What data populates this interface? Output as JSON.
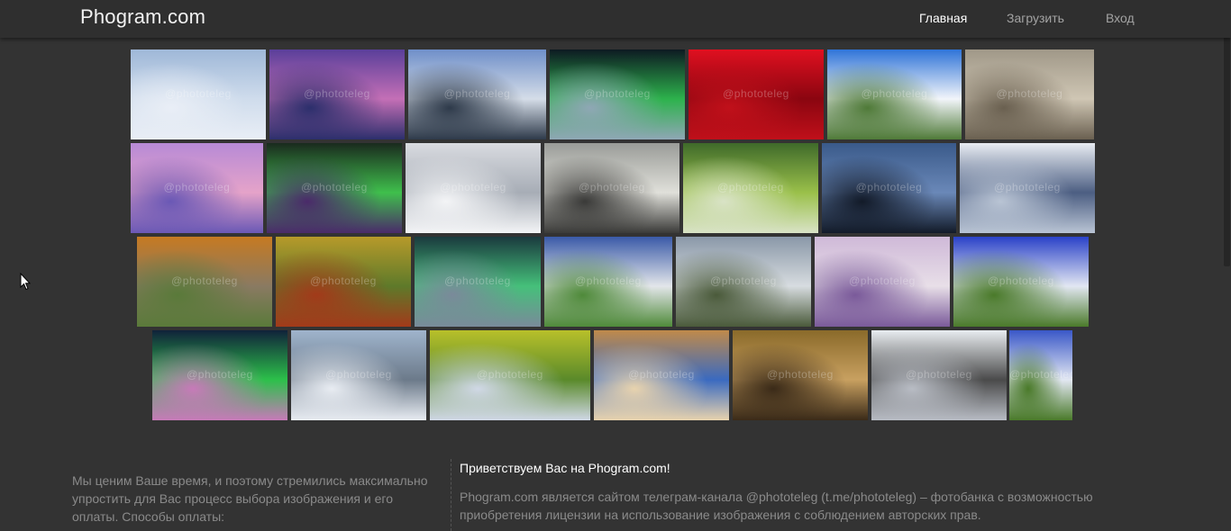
{
  "site": {
    "brand": "Phogram.com"
  },
  "nav": {
    "items": [
      {
        "label": "Главная",
        "active": true
      },
      {
        "label": "Загрузить",
        "active": false
      },
      {
        "label": "Вход",
        "active": false
      }
    ]
  },
  "gallery": {
    "watermark": "@phototeleg",
    "images": [
      {
        "subject": "snowy-larch-forest",
        "colors": [
          "#9fb8d8",
          "#cfdcec",
          "#e9eef6"
        ]
      },
      {
        "subject": "purple-snow-sunset",
        "colors": [
          "#5a3f9a",
          "#c46fb6",
          "#2c2f6c"
        ]
      },
      {
        "subject": "river-wake-clouds",
        "colors": [
          "#6f8fc9",
          "#d5dde8",
          "#2e3a4a"
        ]
      },
      {
        "subject": "aurora-over-trees",
        "colors": [
          "#0d1a22",
          "#2db24c",
          "#8fa7b5"
        ]
      },
      {
        "subject": "red-rose",
        "colors": [
          "#e01020",
          "#8a0510",
          "#c0101a"
        ]
      },
      {
        "subject": "marsh-blue-sky",
        "colors": [
          "#2f74d8",
          "#f2f5fa",
          "#4f7a38"
        ]
      },
      {
        "subject": "lizard-on-rocks",
        "colors": [
          "#a09888",
          "#cfc6b4",
          "#6a6050"
        ]
      },
      {
        "subject": "pink-winter-sky",
        "colors": [
          "#b78ad6",
          "#e5a3c9",
          "#6a58b5"
        ]
      },
      {
        "subject": "aurora-night",
        "colors": [
          "#1a2a1e",
          "#3fbf4c",
          "#4a2a6a"
        ]
      },
      {
        "subject": "snowy-forest-path",
        "colors": [
          "#d9dbe0",
          "#a7adb6",
          "#f3f4f6"
        ]
      },
      {
        "subject": "steller-sea-eagle",
        "colors": [
          "#9a9c98",
          "#e0e0da",
          "#3a3a38"
        ]
      },
      {
        "subject": "green-aurora-snow-trees",
        "colors": [
          "#3f6a2a",
          "#9ac04a",
          "#d9e3c6"
        ]
      },
      {
        "subject": "moon-over-lake",
        "colors": [
          "#3a5a8a",
          "#6a88b8",
          "#121a28"
        ]
      },
      {
        "subject": "melting-ice-floes",
        "colors": [
          "#e8ecf2",
          "#4c5e82",
          "#b9c4d4"
        ]
      },
      {
        "subject": "mushrooms-on-log",
        "colors": [
          "#c67a22",
          "#8a7a62",
          "#5a7a3a"
        ]
      },
      {
        "subject": "boletus-in-moss",
        "colors": [
          "#b79a2a",
          "#5e7a2a",
          "#a23a1a"
        ]
      },
      {
        "subject": "aurora-snowy-spruces",
        "colors": [
          "#1a3a3e",
          "#45c07a",
          "#7a8a9a"
        ]
      },
      {
        "subject": "monastery-field",
        "colors": [
          "#3a5aa8",
          "#e3e6ea",
          "#4f8a3a"
        ]
      },
      {
        "subject": "river-ship-clouds",
        "colors": [
          "#8a98a8",
          "#d7dce0",
          "#4a5a3a"
        ]
      },
      {
        "subject": "snowy-field-sunset",
        "colors": [
          "#cfb9d8",
          "#e8dfe8",
          "#7a5a9a"
        ]
      },
      {
        "subject": "road-blue-sky",
        "colors": [
          "#2a42c8",
          "#e2e7f2",
          "#4a7a2a"
        ]
      },
      {
        "subject": "aurora-road-night",
        "colors": [
          "#10223a",
          "#2cc04a",
          "#c77ab9"
        ]
      },
      {
        "subject": "city-aerial",
        "colors": [
          "#9fb4cc",
          "#6c7a8a",
          "#e8ecf2"
        ]
      },
      {
        "subject": "yellow-green-fields",
        "colors": [
          "#b8c02a",
          "#5a8a2a",
          "#d0d8e6"
        ]
      },
      {
        "subject": "log-pile-sky",
        "colors": [
          "#c08a4a",
          "#3a6ac0",
          "#e8d3ae"
        ]
      },
      {
        "subject": "beehive-frame",
        "colors": [
          "#8a6a2a",
          "#c8a060",
          "#3a2a18"
        ]
      },
      {
        "subject": "snowy-birches",
        "colors": [
          "#e8ecf0",
          "#4a4a4a",
          "#b8bcc4"
        ]
      },
      {
        "subject": "road-clouds-cropped",
        "colors": [
          "#3a58c8",
          "#e2e7f2",
          "#4a7a2a"
        ]
      }
    ]
  },
  "footer": {
    "left_text": "Мы ценим Ваше время, и поэтому стремились максимально упростить для Вас процесс выбора изображения и его оплаты. Способы оплаты:",
    "right_title": "Приветствуем Вас на Phogram.com!",
    "right_text": "Phogram.com является сайтом телеграм-канала @phototeleg (t.me/phototeleg) – фотобанка с возможностью приобретения лицензии на использование изображения с соблюдением авторских прав."
  }
}
